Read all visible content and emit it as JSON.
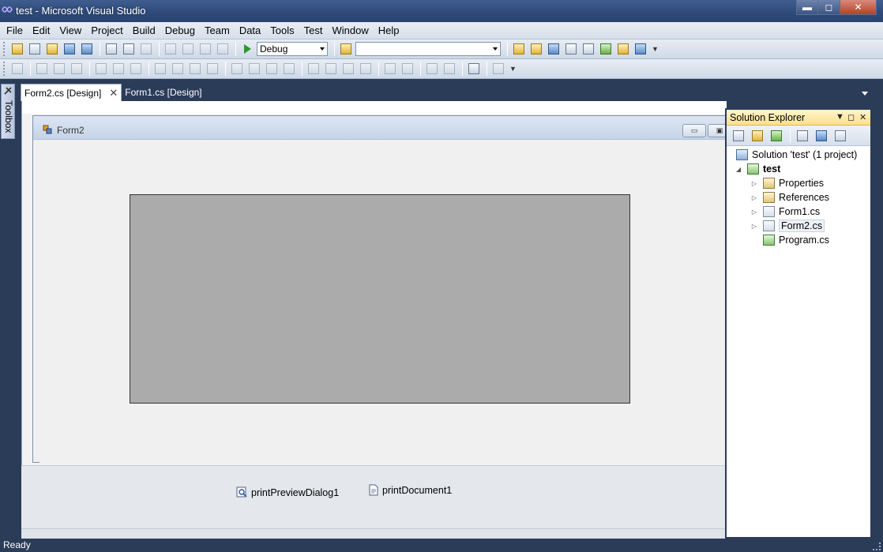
{
  "window": {
    "title": "test - Microsoft Visual Studio",
    "minimize_label": "▬",
    "maximize_label": "◻",
    "close_label": "✕"
  },
  "menu": [
    "File",
    "Edit",
    "View",
    "Project",
    "Build",
    "Debug",
    "Team",
    "Data",
    "Tools",
    "Test",
    "Window",
    "Help"
  ],
  "toolbar": {
    "configuration": "Debug",
    "platform": ""
  },
  "toolbox": {
    "label": "Toolbox"
  },
  "doc_tabs": [
    {
      "label": "Form2.cs [Design]",
      "active": true
    },
    {
      "label": "Form1.cs [Design]",
      "active": false
    }
  ],
  "designer": {
    "form_title": "Form2",
    "form_min_label": "▭",
    "form_max_label": "▣"
  },
  "component_tray": [
    {
      "label": "printPreviewDialog1",
      "icon": "print-preview-icon"
    },
    {
      "label": "printDocument1",
      "icon": "print-document-icon"
    }
  ],
  "solution_explorer": {
    "title": "Solution Explorer",
    "solution_label": "Solution 'test' (1 project)",
    "project_label": "test",
    "items": [
      {
        "label": "Properties",
        "icon": "properties-folder-icon"
      },
      {
        "label": "References",
        "icon": "references-folder-icon"
      },
      {
        "label": "Form1.cs",
        "icon": "form-file-icon"
      },
      {
        "label": "Form2.cs",
        "icon": "form-file-icon"
      },
      {
        "label": "Program.cs",
        "icon": "csharp-file-icon"
      }
    ]
  },
  "status": {
    "text": "Ready"
  }
}
